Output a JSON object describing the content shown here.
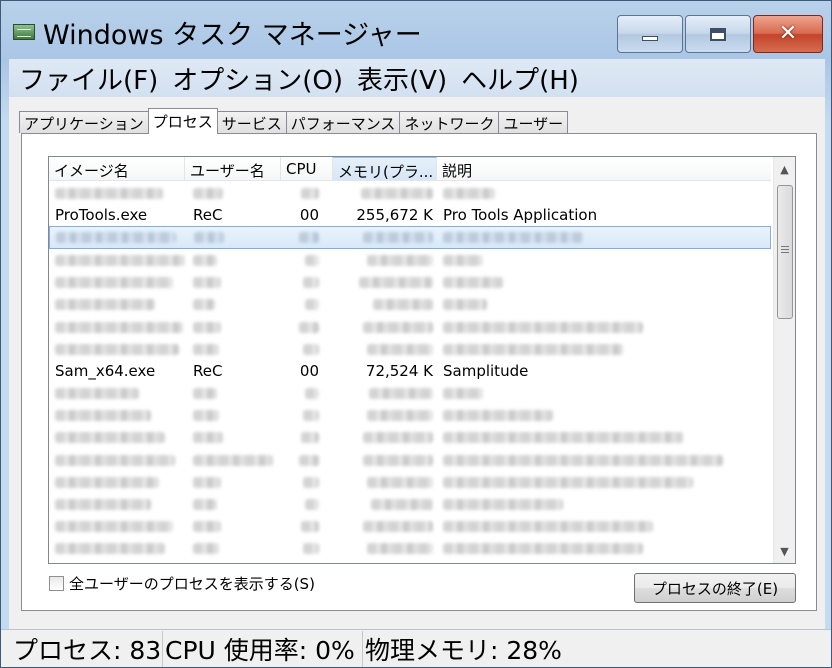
{
  "window": {
    "title": "Windows タスク マネージャー",
    "controls": {
      "minimize": "minimize",
      "maximize": "maximize",
      "close": "close"
    }
  },
  "menu": [
    "ファイル(F)",
    "オプション(O)",
    "表示(V)",
    "ヘルプ(H)"
  ],
  "tabs": [
    {
      "label": "アプリケーション",
      "active": false
    },
    {
      "label": "プロセス",
      "active": true
    },
    {
      "label": "サービス",
      "active": false
    },
    {
      "label": "パフォーマンス",
      "active": false
    },
    {
      "label": "ネットワーク",
      "active": false
    },
    {
      "label": "ユーザー",
      "active": false
    }
  ],
  "columns": [
    "イメージ名",
    "ユーザー名",
    "CPU",
    "メモリ(プラ...",
    "説明"
  ],
  "sorted_column": "メモリ(プラ...",
  "processes": [
    {
      "visible": false,
      "selected": false
    },
    {
      "visible": true,
      "selected": false,
      "image": "ProTools.exe",
      "user": "ReC",
      "cpu": "00",
      "memory": "255,672 K",
      "description": "Pro Tools Application"
    },
    {
      "visible": false,
      "selected": true
    },
    {
      "visible": false,
      "selected": false
    },
    {
      "visible": false,
      "selected": false
    },
    {
      "visible": false,
      "selected": false
    },
    {
      "visible": false,
      "selected": false
    },
    {
      "visible": false,
      "selected": false
    },
    {
      "visible": true,
      "selected": false,
      "image": "Sam_x64.exe",
      "user": "ReC",
      "cpu": "00",
      "memory": "72,524 K",
      "description": "Samplitude"
    },
    {
      "visible": false,
      "selected": false
    },
    {
      "visible": false,
      "selected": false
    },
    {
      "visible": false,
      "selected": false
    },
    {
      "visible": false,
      "selected": false
    },
    {
      "visible": false,
      "selected": false
    },
    {
      "visible": false,
      "selected": false
    },
    {
      "visible": false,
      "selected": false
    },
    {
      "visible": false,
      "selected": false
    }
  ],
  "show_all_users_label": "全ユーザーのプロセスを表示する(S)",
  "end_process_label": "プロセスの終了(E)",
  "status": {
    "processes": "プロセス: 83",
    "cpu": "CPU 使用率: 0%",
    "memory": "物理メモリ: 28%"
  }
}
